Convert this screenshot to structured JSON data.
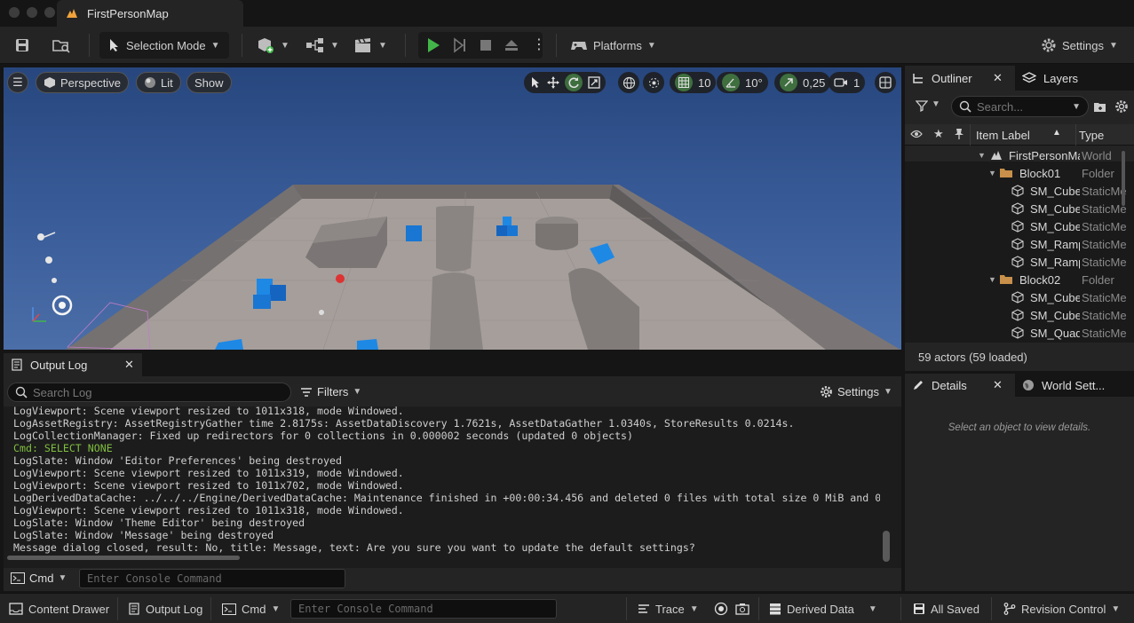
{
  "window": {
    "doc_tab": "FirstPersonMap"
  },
  "toolbar": {
    "selection_mode": "Selection Mode",
    "platforms": "Platforms",
    "settings": "Settings"
  },
  "viewport": {
    "perspective": "Perspective",
    "lit": "Lit",
    "show": "Show",
    "grid_snap": "10",
    "rot_snap": "10°",
    "scale_snap": "0,25",
    "camera_speed": "1"
  },
  "outliner": {
    "tab": "Outliner",
    "layers_tab": "Layers",
    "search_placeholder": "Search...",
    "col_label": "Item Label",
    "col_type": "Type",
    "rows": [
      {
        "label": "FirstPersonMap",
        "type": "World"
      },
      {
        "label": "Block01",
        "type": "Folder"
      },
      {
        "label": "SM_Cube",
        "type": "StaticMesh"
      },
      {
        "label": "SM_Cube",
        "type": "StaticMesh"
      },
      {
        "label": "SM_Cube",
        "type": "StaticMesh"
      },
      {
        "label": "SM_Ramp",
        "type": "StaticMesh"
      },
      {
        "label": "SM_Ramp",
        "type": "StaticMesh"
      },
      {
        "label": "Block02",
        "type": "Folder"
      },
      {
        "label": "SM_Cube",
        "type": "StaticMesh"
      },
      {
        "label": "SM_Cube",
        "type": "StaticMesh"
      },
      {
        "label": "SM_Quad",
        "type": "StaticMesh"
      }
    ],
    "footer": "59 actors (59 loaded)"
  },
  "details": {
    "tab": "Details",
    "world_settings_tab": "World Sett...",
    "empty": "Select an object to view details."
  },
  "output_log": {
    "tab": "Output Log",
    "search_placeholder": "Search Log",
    "filters": "Filters",
    "settings": "Settings",
    "lines": [
      "LogViewport: Scene viewport resized to 1011x318, mode Windowed.",
      "LogAssetRegistry: AssetRegistryGather time 2.8175s: AssetDataDiscovery 1.7621s, AssetDataGather 1.0340s, StoreResults 0.0214s.",
      "LogCollectionManager: Fixed up redirectors for 0 collections in 0.000002 seconds (updated 0 objects)",
      "Cmd: SELECT NONE",
      "LogSlate: Window 'Editor Preferences' being destroyed",
      "LogViewport: Scene viewport resized to 1011x319, mode Windowed.",
      "LogViewport: Scene viewport resized to 1011x702, mode Windowed.",
      "LogDerivedDataCache: ../../../Engine/DerivedDataCache: Maintenance finished in +00:00:34.456 and deleted 0 files with total size 0 MiB and 0",
      "LogViewport: Scene viewport resized to 1011x318, mode Windowed.",
      "LogSlate: Window 'Theme Editor' being destroyed",
      "LogSlate: Window 'Message' being destroyed",
      "Message dialog closed, result: No, title: Message, text: Are you sure you want to update the default settings?"
    ],
    "cmd_label": "Cmd",
    "console_placeholder": "Enter Console Command"
  },
  "statusbar": {
    "content_drawer": "Content Drawer",
    "output_log": "Output Log",
    "cmd": "Cmd",
    "console_placeholder": "Enter Console Command",
    "trace": "Trace",
    "derived_data": "Derived Data",
    "all_saved": "All Saved",
    "revision_control": "Revision Control"
  },
  "colors": {
    "accent_green": "#43b64a",
    "cmd_line": "#7fbf3f",
    "cube_blue": "#1976d2",
    "ue_orange": "#f2a33a"
  }
}
